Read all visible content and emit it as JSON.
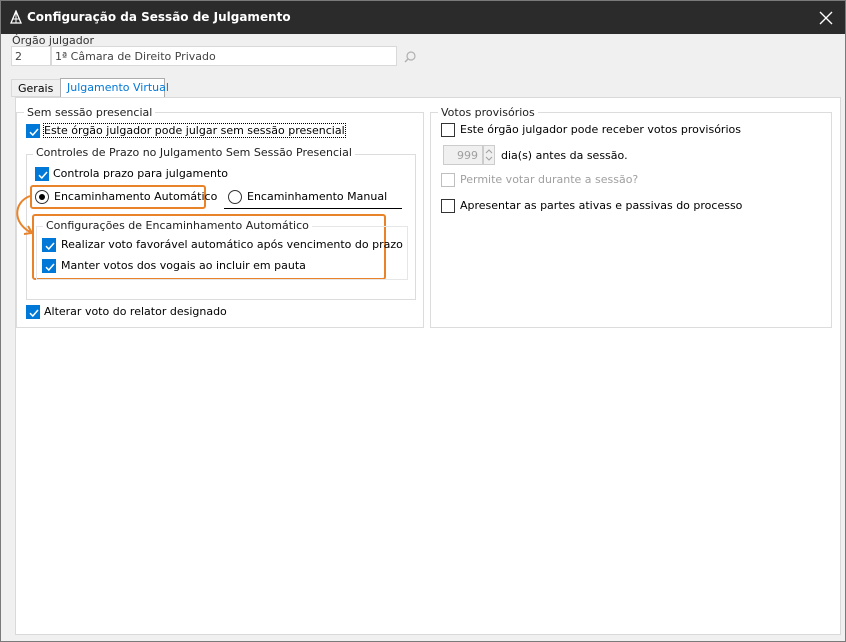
{
  "window": {
    "title": "Configuração da Sessão de Julgamento"
  },
  "orgao": {
    "label": "Órgão julgador",
    "code": "2",
    "name": "1ª Câmara de Direito Privado"
  },
  "tabs": [
    {
      "label": "Gerais",
      "active": false
    },
    {
      "label": "Julgamento Virtual",
      "active": true
    }
  ],
  "sem_sessao": {
    "title": "Sem sessão presencial",
    "pode_julgar": {
      "label": "Este órgão julgador pode julgar sem sessão presencial",
      "checked": true
    },
    "controles": {
      "title": "Controles de Prazo no Julgamento Sem Sessão Presencial",
      "controla_prazo": {
        "label": "Controla prazo para julgamento",
        "checked": true
      },
      "radio_auto": {
        "label": "Encaminhamento Automático",
        "selected": true
      },
      "radio_manual": {
        "label": "Encaminhamento Manual",
        "selected": false
      },
      "config": {
        "title": "Configurações de Encaminhamento Automático",
        "voto_favoravel": {
          "label": "Realizar voto favorável automático após vencimento do prazo",
          "checked": true
        },
        "manter_votos": {
          "label": "Manter votos dos vogais ao incluir em pauta",
          "checked": true
        }
      }
    },
    "alterar_voto": {
      "label": "Alterar voto do relator designado",
      "checked": true
    }
  },
  "votos": {
    "title": "Votos provisórios",
    "pode_receber": {
      "label": "Este órgão julgador pode receber votos provisórios",
      "checked": false
    },
    "dias_value": "999",
    "dias_label": "dia(s) antes da sessão.",
    "permite_votar": {
      "label": "Permite votar durante a sessão?",
      "checked": false,
      "disabled": true
    },
    "apresentar_partes": {
      "label": "Apresentar as partes ativas e passivas do processo",
      "checked": false
    }
  },
  "colors": {
    "accent": "#0078d7",
    "highlight": "#e8832a",
    "titlebar": "#2b2b2b"
  },
  "icons": {
    "app": "scales-icon",
    "close": "close-icon",
    "search": "search-icon",
    "check": "check-icon"
  }
}
